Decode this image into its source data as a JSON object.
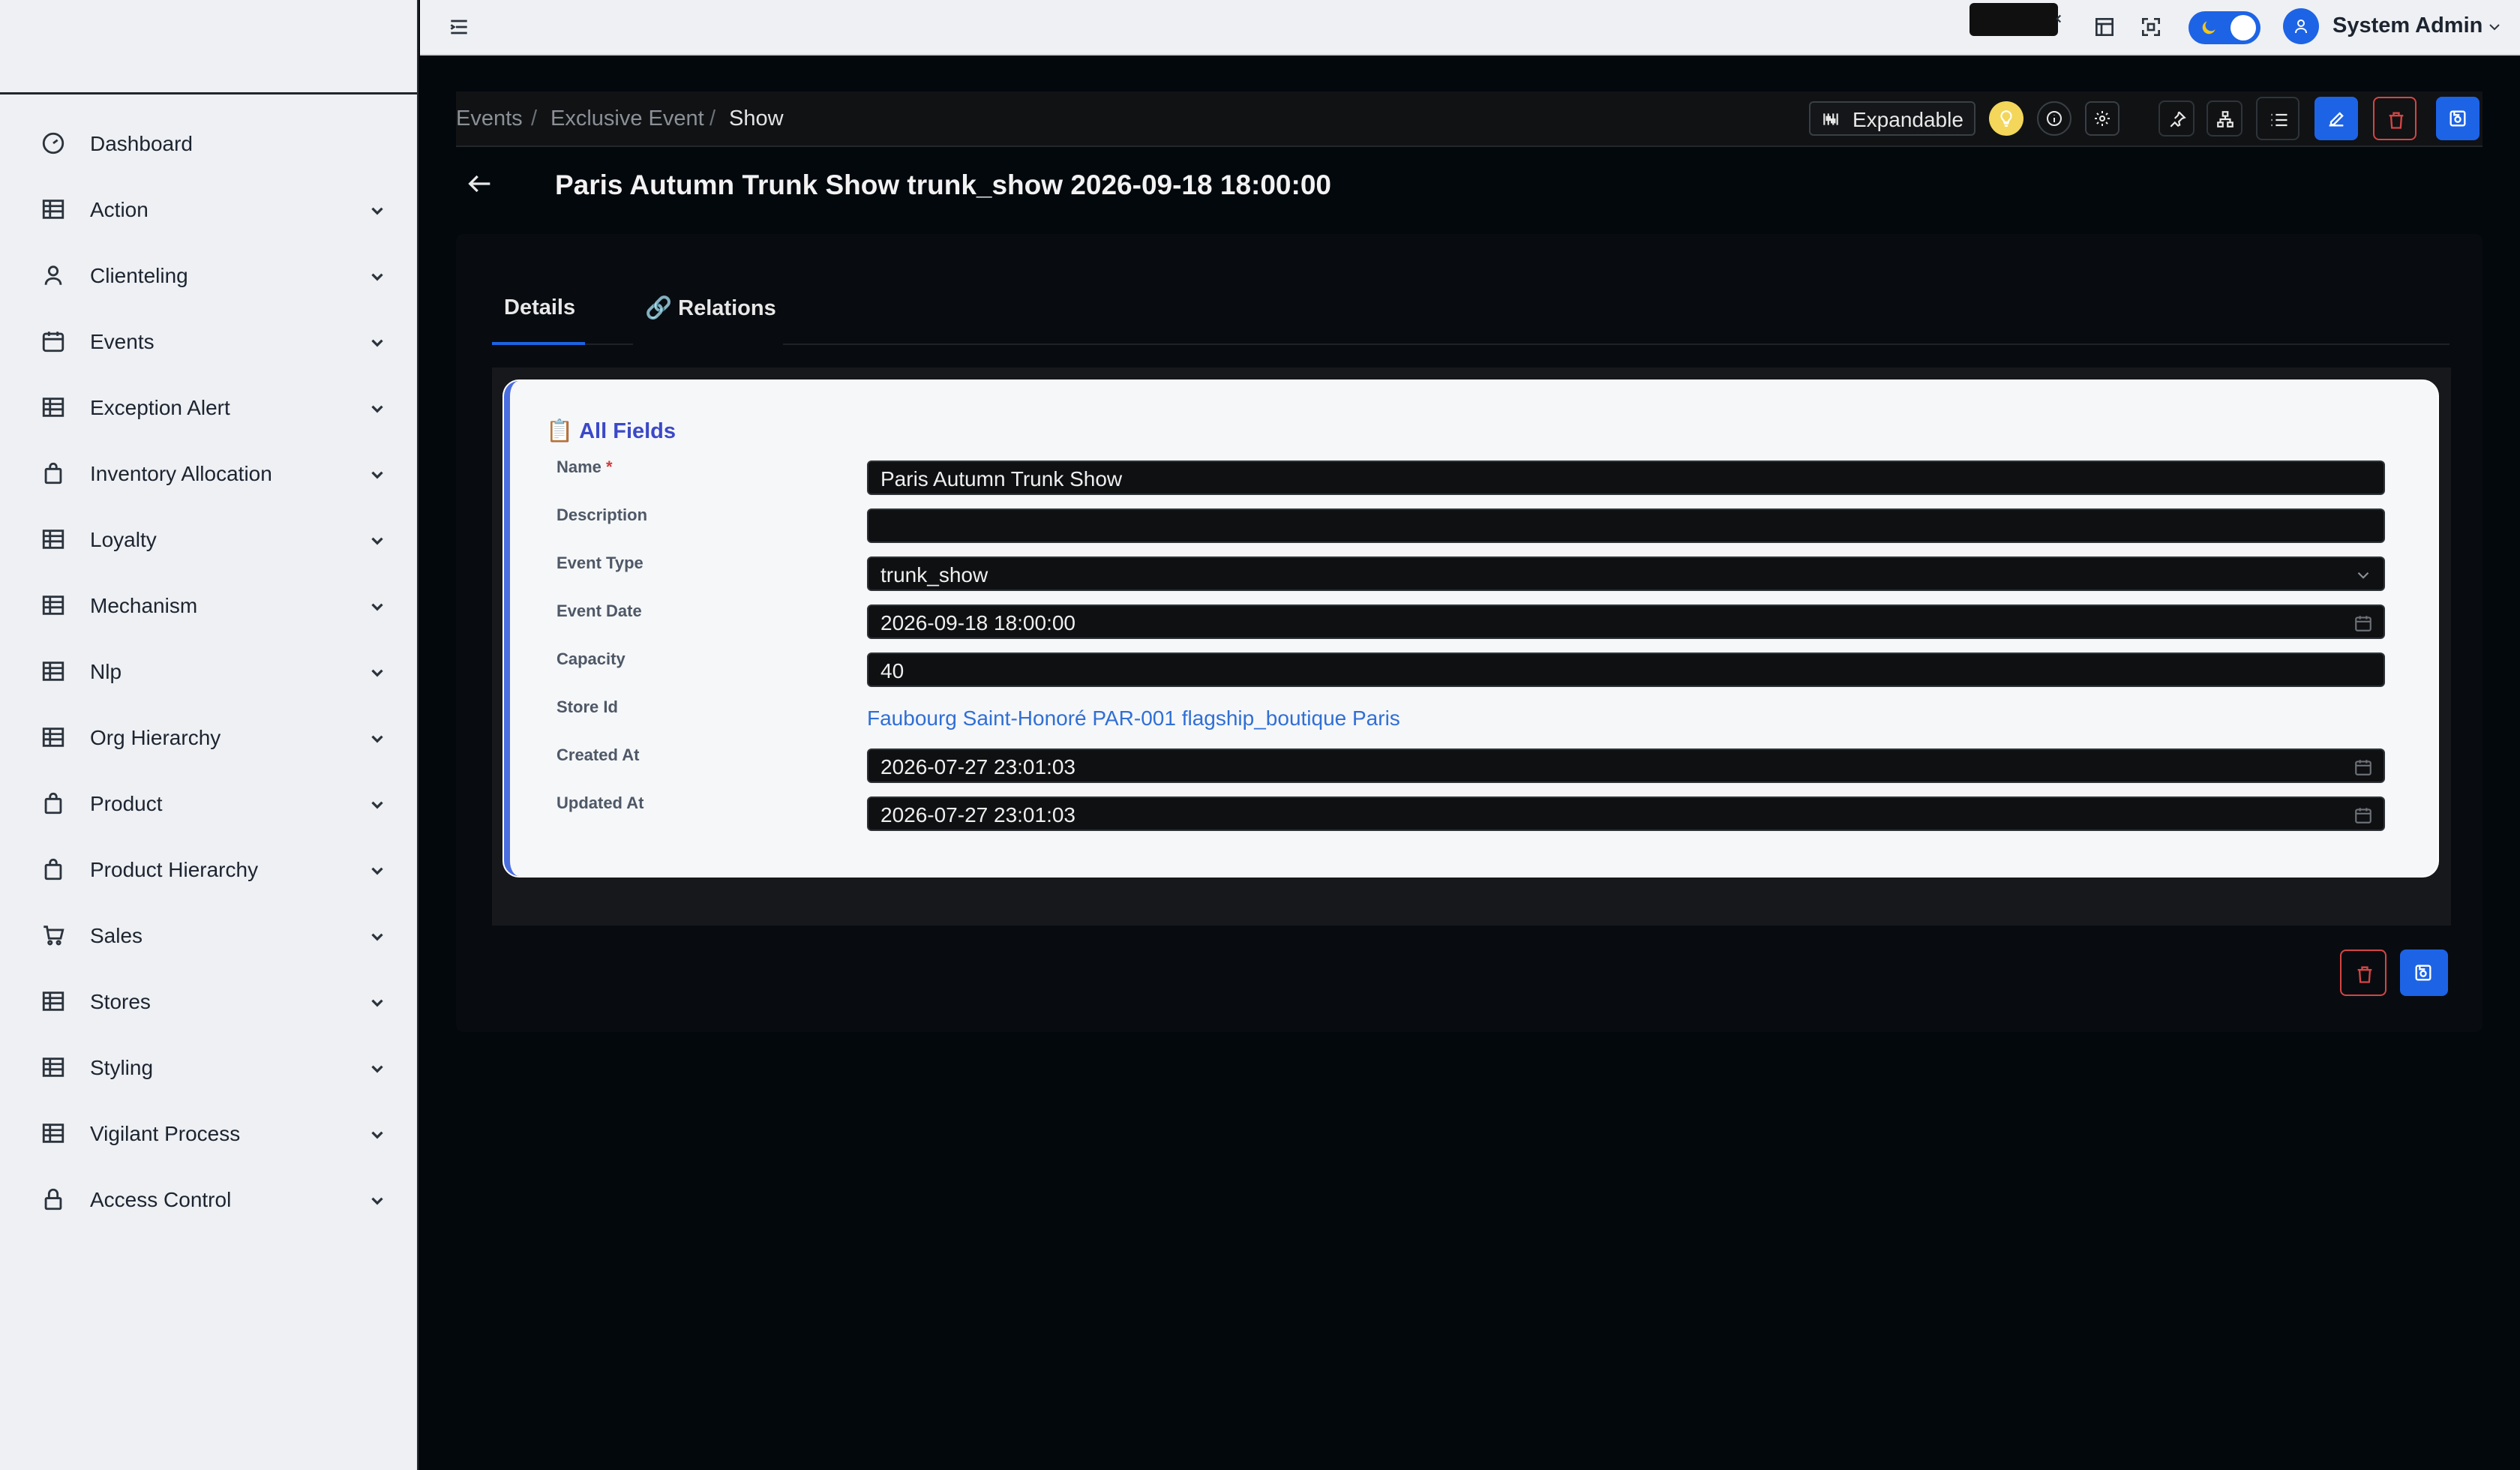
{
  "sidebar": {
    "items": [
      {
        "label": "Dashboard",
        "icon": "dashboard-icon",
        "expandable": false
      },
      {
        "label": "Action",
        "icon": "table-icon",
        "expandable": true
      },
      {
        "label": "Clienteling",
        "icon": "user-icon",
        "expandable": true
      },
      {
        "label": "Events",
        "icon": "calendar-icon",
        "expandable": true
      },
      {
        "label": "Exception Alert",
        "icon": "table-icon",
        "expandable": true
      },
      {
        "label": "Inventory Allocation",
        "icon": "bag-icon",
        "expandable": true
      },
      {
        "label": "Loyalty",
        "icon": "table-icon",
        "expandable": true
      },
      {
        "label": "Mechanism",
        "icon": "table-icon",
        "expandable": true
      },
      {
        "label": "Nlp",
        "icon": "table-icon",
        "expandable": true
      },
      {
        "label": "Org Hierarchy",
        "icon": "table-icon",
        "expandable": true
      },
      {
        "label": "Product",
        "icon": "bag-icon",
        "expandable": true
      },
      {
        "label": "Product Hierarchy",
        "icon": "bag-icon",
        "expandable": true
      },
      {
        "label": "Sales",
        "icon": "cart-icon",
        "expandable": true
      },
      {
        "label": "Stores",
        "icon": "table-icon",
        "expandable": true
      },
      {
        "label": "Styling",
        "icon": "table-icon",
        "expandable": true
      },
      {
        "label": "Vigilant Process",
        "icon": "table-icon",
        "expandable": true
      },
      {
        "label": "Access Control",
        "icon": "lock-icon",
        "expandable": true
      }
    ]
  },
  "topbar": {
    "user_name": "System Admin",
    "theme": "dark",
    "accent": "#1d63e6"
  },
  "breadcrumb": {
    "items": [
      "Events",
      "Exclusive Event",
      "Show"
    ],
    "separator": "/"
  },
  "toolbar": {
    "expandable_label": "Expandable"
  },
  "page": {
    "title": "Paris Autumn Trunk Show trunk_show 2026-09-18 18:00:00"
  },
  "tabs": [
    {
      "label": "Details",
      "active": true
    },
    {
      "label": "🔗 Relations",
      "active": false
    }
  ],
  "card": {
    "title": "All Fields",
    "title_icon": "📋"
  },
  "fields": {
    "name": {
      "label": "Name",
      "value": "Paris Autumn Trunk Show",
      "required": "*"
    },
    "description": {
      "label": "Description",
      "value": ""
    },
    "event_type": {
      "label": "Event Type",
      "value": "trunk_show"
    },
    "event_date": {
      "label": "Event Date",
      "value": "2026-09-18 18:00:00"
    },
    "capacity": {
      "label": "Capacity",
      "value": "40"
    },
    "store_id": {
      "label": "Store Id",
      "value": "Faubourg Saint-Honoré PAR-001 flagship_boutique Paris"
    },
    "created_at": {
      "label": "Created At",
      "value": "2026-07-27 23:01:03"
    },
    "updated_at": {
      "label": "Updated At",
      "value": "2026-07-27 23:01:03"
    }
  },
  "colors": {
    "primary": "#1d63e6",
    "danger": "#d64545",
    "link": "#2f6fd6",
    "card_title": "#3b49c8"
  }
}
